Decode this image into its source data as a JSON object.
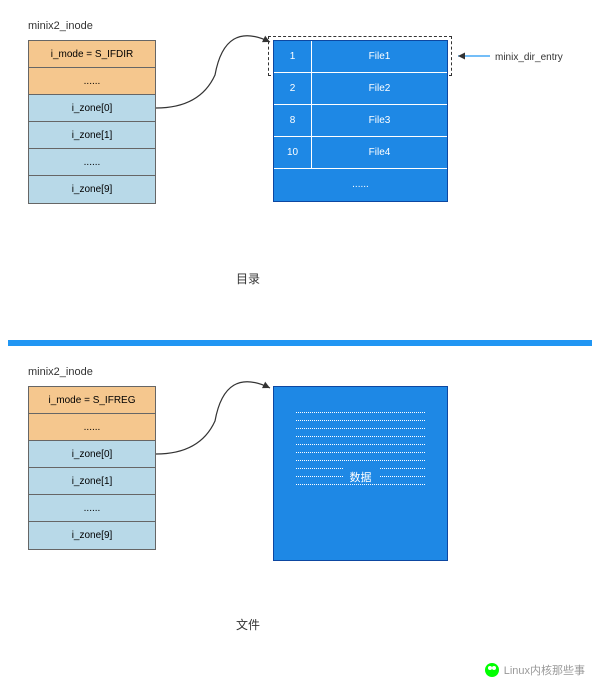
{
  "section1": {
    "struct_name": "minix2_inode",
    "inode": {
      "mode": "i_mode = S_IFDIR",
      "dots1": "......",
      "zones": [
        "i_zone[0]",
        "i_zone[1]",
        "......",
        "i_zone[9]"
      ]
    },
    "dir_entries": [
      {
        "num": "1",
        "name": "File1"
      },
      {
        "num": "2",
        "name": "File2"
      },
      {
        "num": "8",
        "name": "File3"
      },
      {
        "num": "10",
        "name": "File4"
      }
    ],
    "dir_last": "......",
    "entry_label": "minix_dir_entry",
    "caption": "目录"
  },
  "section2": {
    "struct_name": "minix2_inode",
    "inode": {
      "mode": "i_mode = S_IFREG",
      "dots1": "......",
      "zones": [
        "i_zone[0]",
        "i_zone[1]",
        "......",
        "i_zone[9]"
      ]
    },
    "data_label": "数据",
    "caption": "文件"
  },
  "watermark": "Linux内核那些事"
}
